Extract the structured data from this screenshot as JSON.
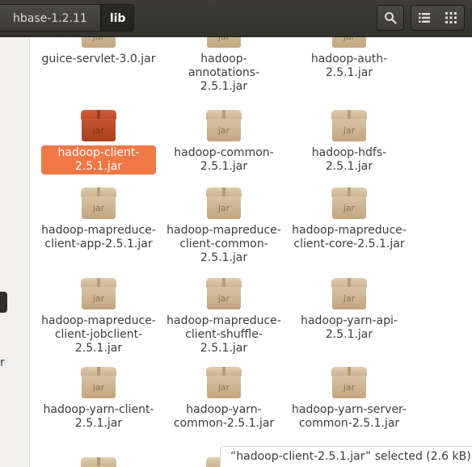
{
  "header": {
    "path": [
      {
        "label": "hbase-1.2.11"
      },
      {
        "label": "lib"
      }
    ]
  },
  "colors": {
    "header_bg": "#3c3b37",
    "selection": "#f07746",
    "selected_icon": "#c95532",
    "icon_normal": "#d8c3a3"
  },
  "icons": {
    "search": "search-icon",
    "list_view": "list-view-icon",
    "grid_view": "grid-view-icon",
    "file": "jar-archive-icon"
  },
  "files": [
    {
      "name": "guice-servlet-3.0.jar",
      "tag": "jar",
      "selected": false
    },
    {
      "name": "hadoop-annotations-2.5.1.jar",
      "tag": "jar",
      "selected": false
    },
    {
      "name": "hadoop-auth-2.5.1.jar",
      "tag": "jar",
      "selected": false
    },
    {
      "name": "hadoop-client-2.5.1.jar",
      "tag": "jar",
      "selected": true
    },
    {
      "name": "hadoop-common-2.5.1.jar",
      "tag": "jar",
      "selected": false
    },
    {
      "name": "hadoop-hdfs-2.5.1.jar",
      "tag": "jar",
      "selected": false
    },
    {
      "name": "hadoop-mapreduce-client-app-2.5.1.jar",
      "tag": "jar",
      "selected": false
    },
    {
      "name": "hadoop-mapreduce-client-common-2.5.1.jar",
      "tag": "jar",
      "selected": false
    },
    {
      "name": "hadoop-mapreduce-client-core-2.5.1.jar",
      "tag": "jar",
      "selected": false
    },
    {
      "name": "hadoop-mapreduce-client-jobclient-2.5.1.jar",
      "tag": "jar",
      "selected": false
    },
    {
      "name": "hadoop-mapreduce-client-shuffle-2.5.1.jar",
      "tag": "jar",
      "selected": false
    },
    {
      "name": "hadoop-yarn-api-2.5.1.jar",
      "tag": "jar",
      "selected": false
    },
    {
      "name": "hadoop-yarn-client-2.5.1.jar",
      "tag": "jar",
      "selected": false
    },
    {
      "name": "hadoop-yarn-common-2.5.1.jar",
      "tag": "jar",
      "selected": false
    },
    {
      "name": "hadoop-yarn-server-common-2.5.1.jar",
      "tag": "jar",
      "selected": false
    }
  ],
  "sidebar": {
    "partial_letter": "r"
  },
  "status": {
    "text": "“hadoop-client-2.5.1.jar” selected  (2.6 kB)"
  }
}
